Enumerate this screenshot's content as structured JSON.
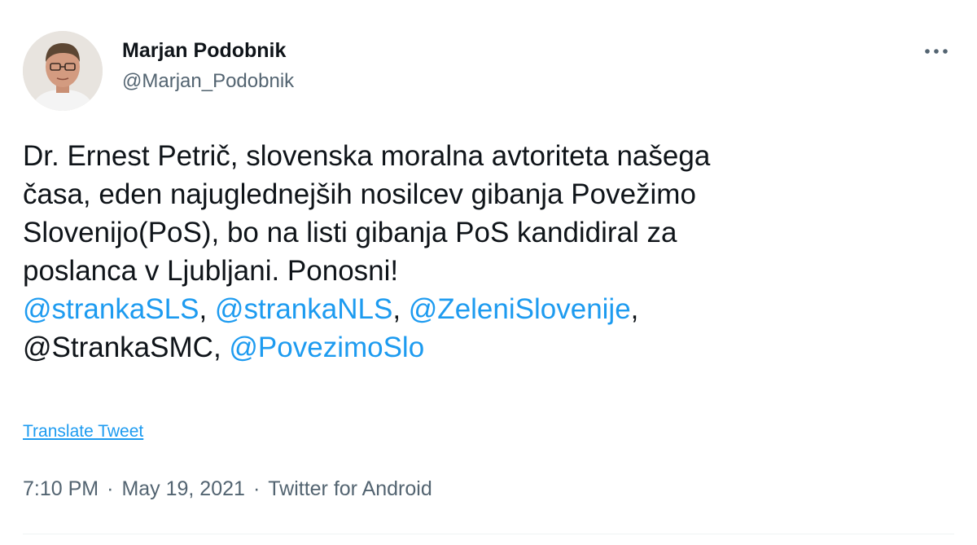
{
  "author": {
    "display_name": "Marjan Podobnik",
    "handle": "@Marjan_Podobnik"
  },
  "more_icon": "more-horizontal-icon",
  "tweet": {
    "body": "Dr. Ernest Petrič, slovenska moralna avtoriteta našega\nčasa, eden najuglednejših nosilcev gibanja Povežimo\nSlovenijo(PoS), bo na listi gibanja PoS kandidiral za\nposlanca v Ljubljani. Ponosni!",
    "mentions": [
      {
        "text": "@strankaSLS",
        "linked": true
      },
      {
        "text": ", ",
        "linked": false
      },
      {
        "text": "@strankaNLS",
        "linked": true
      },
      {
        "text": ", ",
        "linked": false
      },
      {
        "text": "@ZeleniSlovenije",
        "linked": true
      },
      {
        "text": ",\n",
        "linked": false
      },
      {
        "text": "@StrankaSMC",
        "linked": false
      },
      {
        "text": ", ",
        "linked": false
      },
      {
        "text": "@PovezimoSlo",
        "linked": true
      }
    ]
  },
  "translate_label": "Translate Tweet",
  "meta": {
    "time": "7:10 PM",
    "separator": "·",
    "date": "May 19, 2021",
    "source": "Twitter for Android"
  },
  "colors": {
    "link": "#1d9bf0",
    "text": "#0f1419",
    "secondary": "#536471"
  }
}
